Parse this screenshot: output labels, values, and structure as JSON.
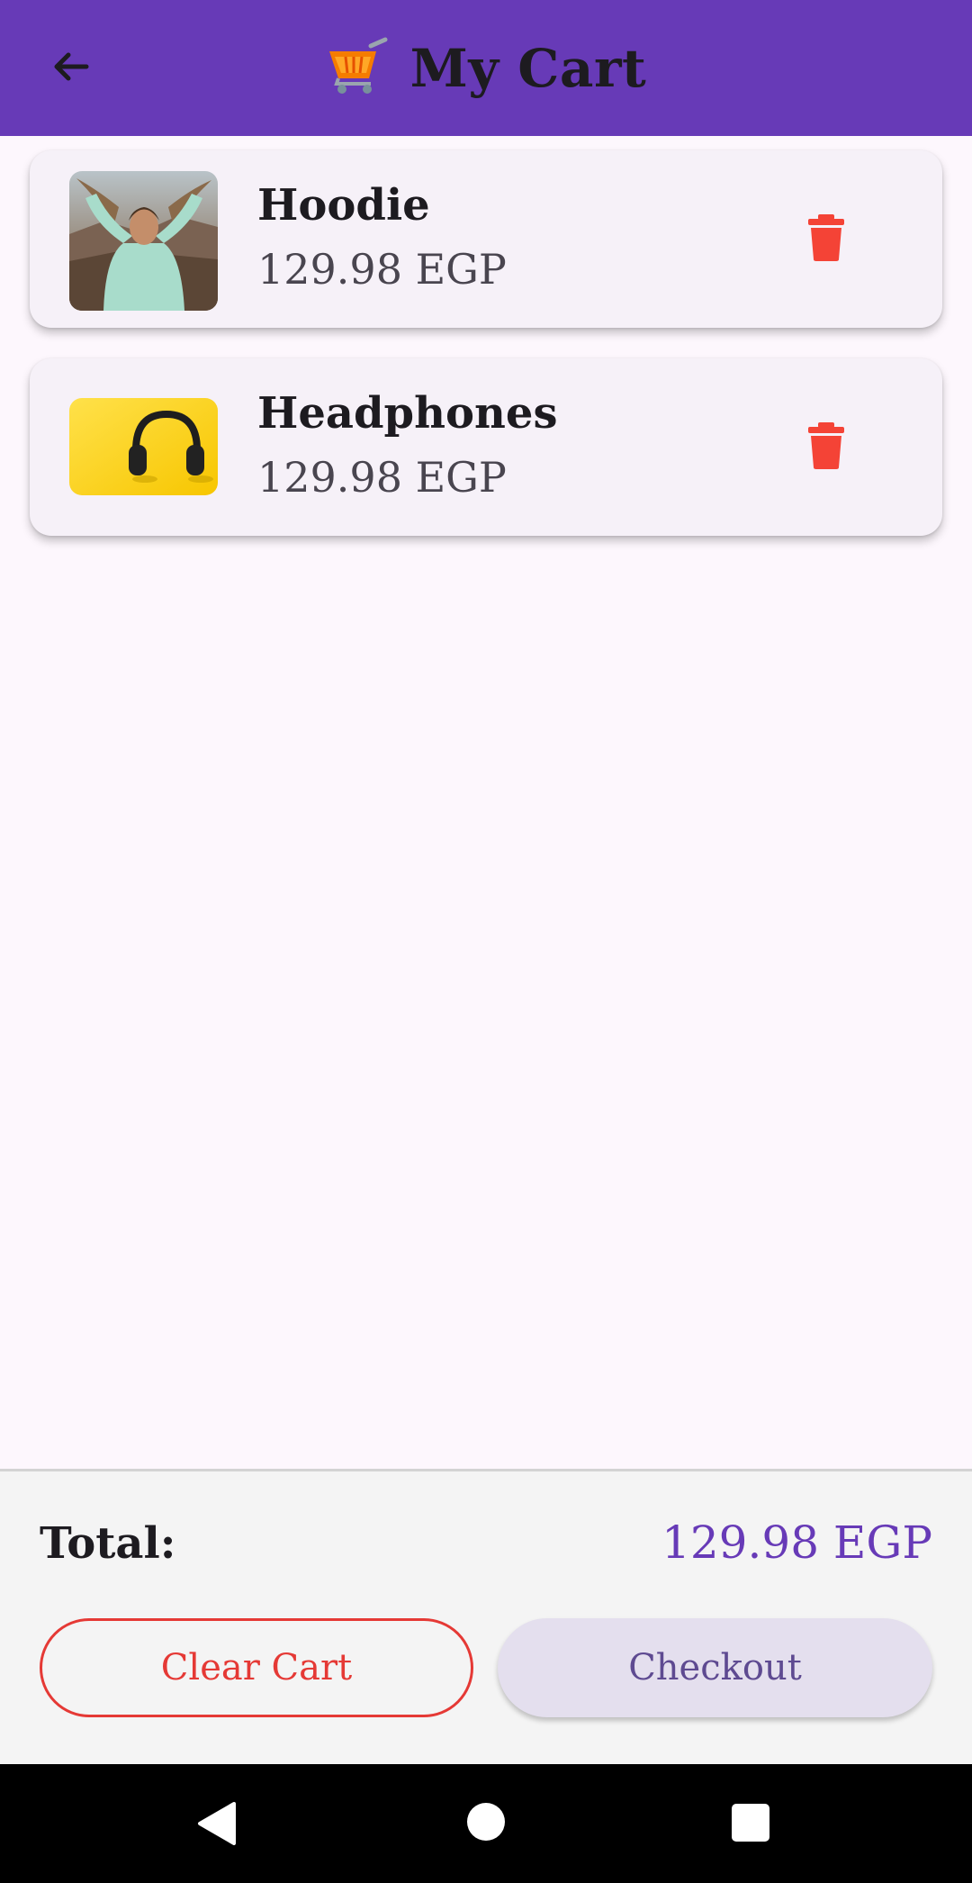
{
  "appbar": {
    "title": "My Cart",
    "title_icon": "shopping-cart-icon",
    "back_icon": "arrow-back-icon"
  },
  "cart_items": [
    {
      "name": "Hoodie",
      "price": "129.98 EGP",
      "image": "hoodie-photo",
      "delete_icon": "trash-icon"
    },
    {
      "name": "Headphones",
      "price": "129.98 EGP",
      "image": "headphones-photo",
      "delete_icon": "trash-icon"
    }
  ],
  "summary": {
    "total_label": "Total:",
    "total_value": "129.98 EGP"
  },
  "actions": {
    "clear_label": "Clear Cart",
    "checkout_label": "Checkout"
  },
  "colors": {
    "primary": "#673AB7",
    "danger": "#E53935",
    "background": "#FDF7FD"
  },
  "system_nav": {
    "back_icon": "nav-back-icon",
    "home_icon": "nav-home-icon",
    "recents_icon": "nav-recents-icon"
  }
}
